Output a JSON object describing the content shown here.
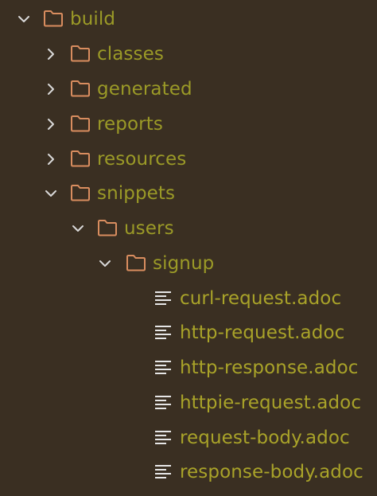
{
  "theme": {
    "background": "#3a2f22",
    "label_color": "#9b9a27",
    "folder_color": "#d98d5f",
    "chevron_color": "#d9d9d9",
    "file_icon_color": "#e6e6e6"
  },
  "tree": {
    "items": [
      {
        "label": "build",
        "type": "folder",
        "state": "expanded",
        "chevron_icon": "chevron-down-icon",
        "icon": "folder-icon"
      },
      {
        "label": "classes",
        "type": "folder",
        "state": "collapsed",
        "chevron_icon": "chevron-right-icon",
        "icon": "folder-icon"
      },
      {
        "label": "generated",
        "type": "folder",
        "state": "collapsed",
        "chevron_icon": "chevron-right-icon",
        "icon": "folder-icon"
      },
      {
        "label": "reports",
        "type": "folder",
        "state": "collapsed",
        "chevron_icon": "chevron-right-icon",
        "icon": "folder-icon"
      },
      {
        "label": "resources",
        "type": "folder",
        "state": "collapsed",
        "chevron_icon": "chevron-right-icon",
        "icon": "folder-icon"
      },
      {
        "label": "snippets",
        "type": "folder",
        "state": "expanded",
        "chevron_icon": "chevron-down-icon",
        "icon": "folder-icon"
      },
      {
        "label": "users",
        "type": "folder",
        "state": "expanded",
        "chevron_icon": "chevron-down-icon",
        "icon": "folder-icon"
      },
      {
        "label": "signup",
        "type": "folder",
        "state": "expanded",
        "chevron_icon": "chevron-down-icon",
        "icon": "folder-icon"
      },
      {
        "label": "curl-request.adoc",
        "type": "file",
        "icon": "text-file-icon"
      },
      {
        "label": "http-request.adoc",
        "type": "file",
        "icon": "text-file-icon"
      },
      {
        "label": "http-response.adoc",
        "type": "file",
        "icon": "text-file-icon"
      },
      {
        "label": "httpie-request.adoc",
        "type": "file",
        "icon": "text-file-icon"
      },
      {
        "label": "request-body.adoc",
        "type": "file",
        "icon": "text-file-icon"
      },
      {
        "label": "response-body.adoc",
        "type": "file",
        "icon": "text-file-icon"
      }
    ]
  }
}
